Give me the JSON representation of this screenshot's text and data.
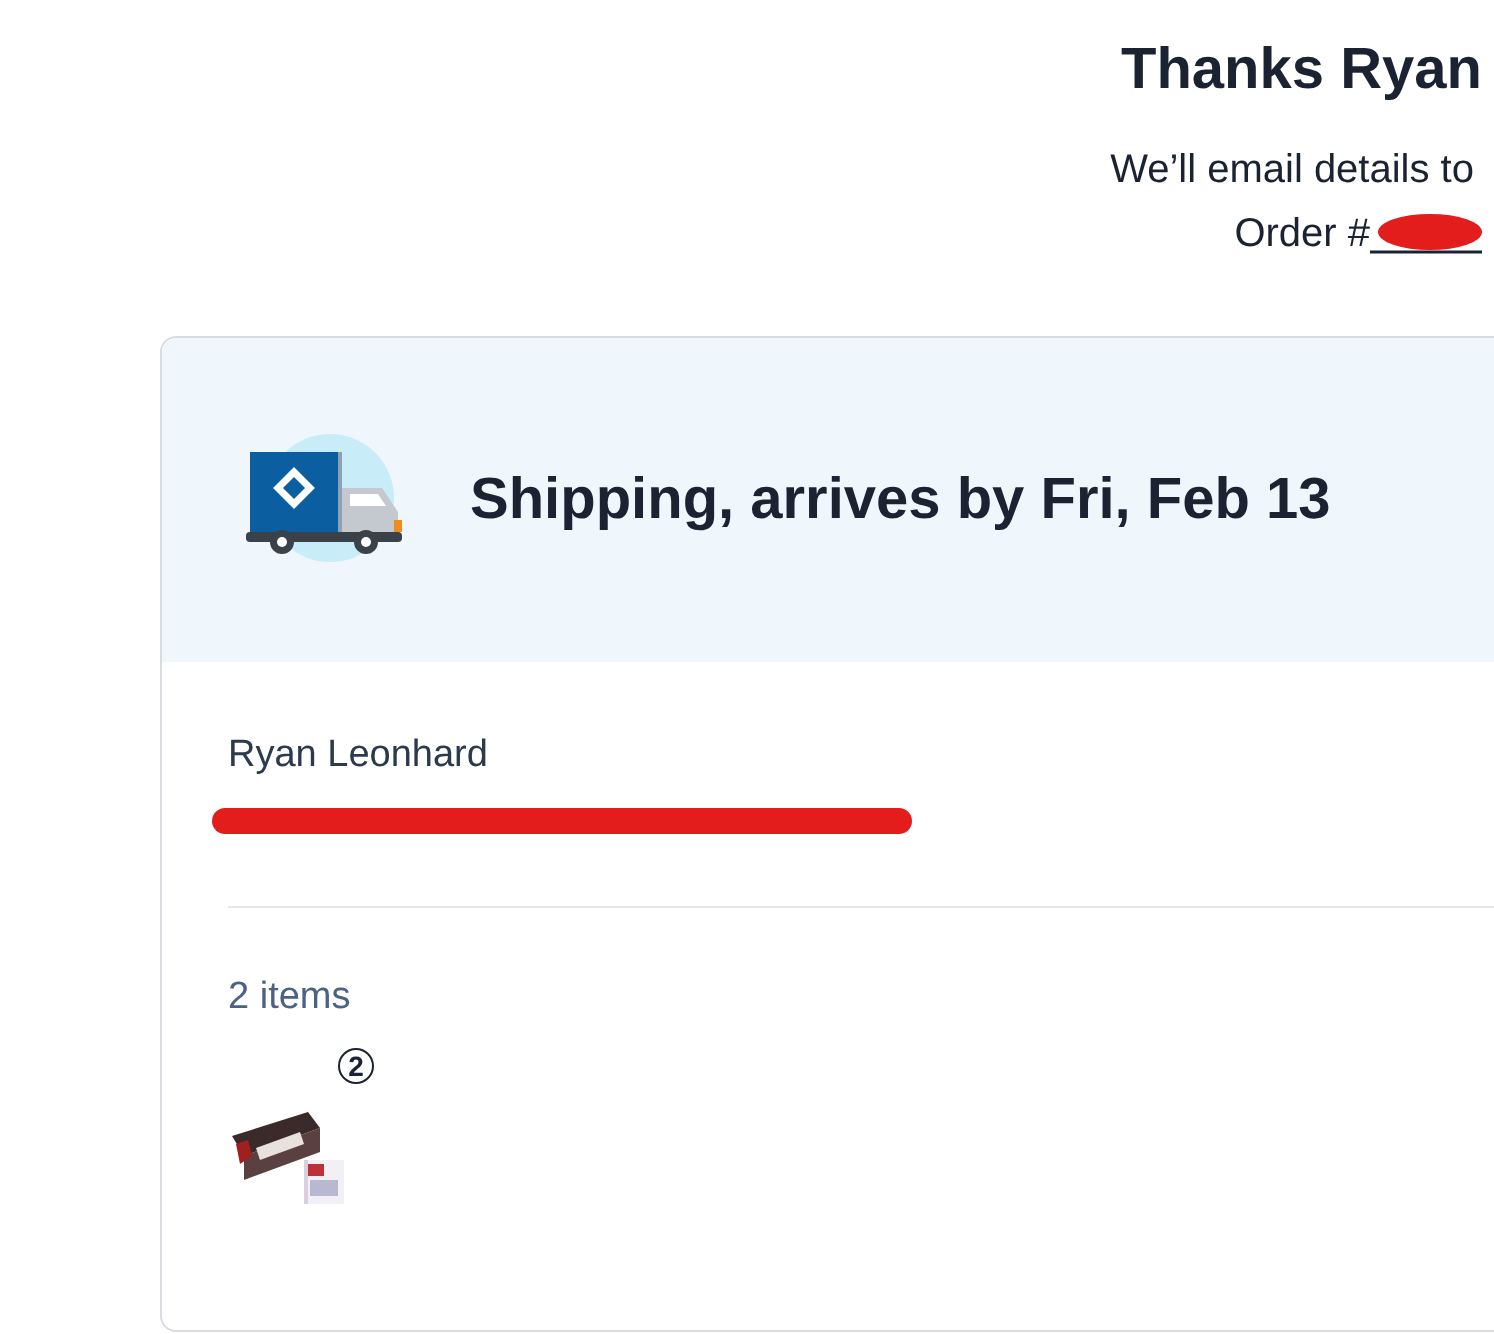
{
  "header": {
    "title": "Thanks Ryan",
    "message": "We’ll email details to",
    "order_label": "Order #"
  },
  "shipment": {
    "title": "Shipping, arrives by Fri, Feb 13",
    "recipient": "Ryan Leonhard",
    "item_count": "2 items",
    "items": [
      {
        "kind": "picture",
        "quantity": "2"
      }
    ]
  }
}
